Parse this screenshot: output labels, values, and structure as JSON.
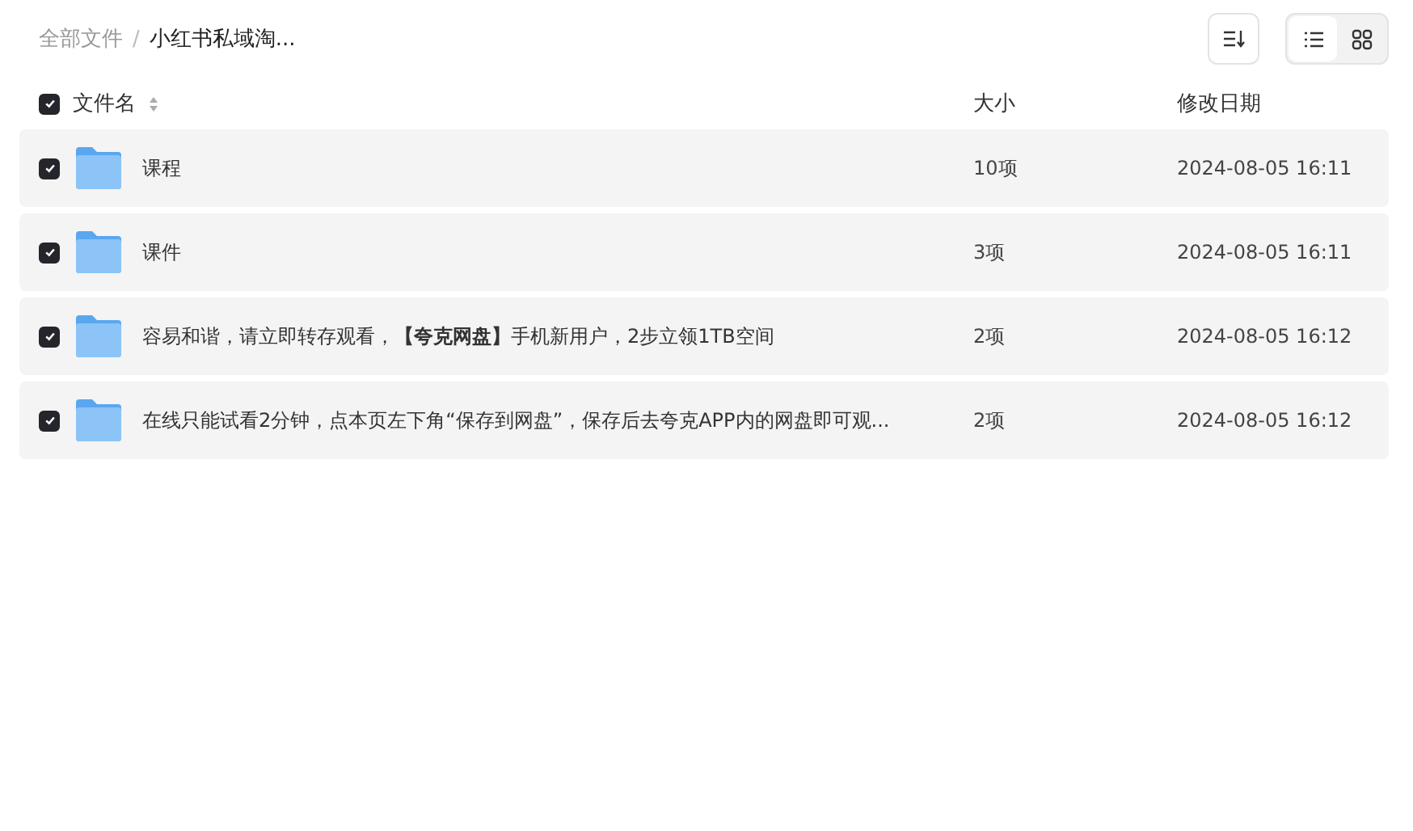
{
  "breadcrumb": [
    {
      "label": "全部文件",
      "current": false
    },
    {
      "label": "小红书私域淘...",
      "current": true
    }
  ],
  "breadcrumb_separator": "/",
  "view_modes": [
    {
      "kind": "list",
      "selected": true
    },
    {
      "kind": "grid",
      "selected": false
    }
  ],
  "table": {
    "select_all_checked": true,
    "columns": [
      "文件名",
      "大小",
      "修改日期"
    ],
    "rows": [
      {
        "checked": true,
        "name": "课程",
        "size": "10项",
        "modified": "2024-08-05 16:11"
      },
      {
        "checked": true,
        "name": "课件",
        "size": "3项",
        "modified": "2024-08-05 16:11"
      },
      {
        "checked": true,
        "name": "容易和谐，请立即转存观看，**【夸克网盘】**手机新用户，2步立领1TB空间",
        "size": "2项",
        "modified": "2024-08-05 16:12"
      },
      {
        "checked": true,
        "name": "在线只能试看2分钟，点本页左下角“保存到网盘”，保存后去夸克APP内的网盘即可观...",
        "size": "2项",
        "modified": "2024-08-05 16:12"
      }
    ]
  }
}
